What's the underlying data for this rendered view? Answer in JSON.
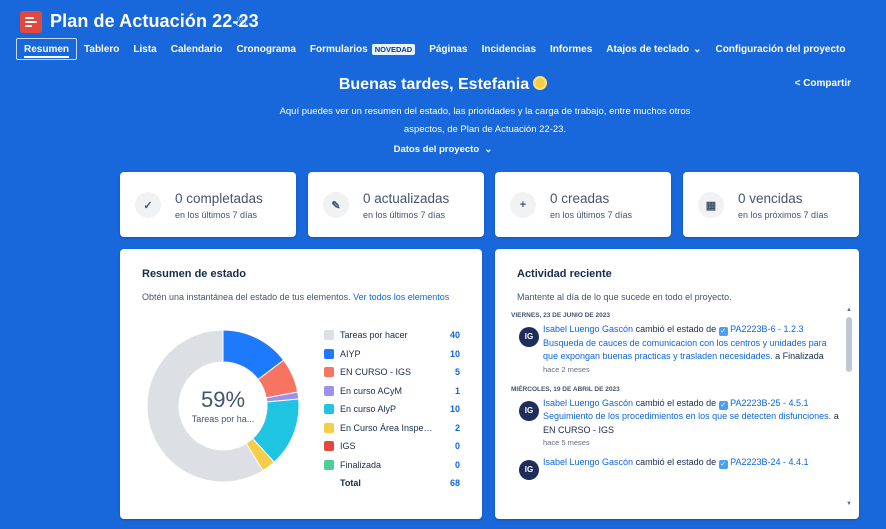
{
  "header": {
    "title": "Plan de Actuación 22-23",
    "tabs": [
      {
        "label": "Resumen",
        "active": true
      },
      {
        "label": "Tablero"
      },
      {
        "label": "Lista"
      },
      {
        "label": "Calendario"
      },
      {
        "label": "Cronograma"
      },
      {
        "label": "Formularios",
        "badge": "NOVEDAD"
      },
      {
        "label": "Páginas"
      },
      {
        "label": "Incidencias"
      },
      {
        "label": "Informes"
      },
      {
        "label": "Atajos de teclado",
        "chevron": true
      },
      {
        "label": "Configuración del proyecto"
      }
    ]
  },
  "hero": {
    "greeting": "Buenas tardes, Estefania",
    "share": "Compartir",
    "intro": "Aquí puedes ver un resumen del estado, las prioridades y la carga de trabajo, entre muchos otros aspectos, de Plan de Actuación 22-23.",
    "project_data": "Datos del proyecto"
  },
  "stats": [
    {
      "icon": "check-icon",
      "value": "0 completadas",
      "period": "en los últimos 7 días"
    },
    {
      "icon": "pencil-icon",
      "value": "0 actualizadas",
      "period": "en los últimos 7 días"
    },
    {
      "icon": "plus-icon",
      "value": "0 creadas",
      "period": "en los últimos 7 días"
    },
    {
      "icon": "calendar-icon",
      "value": "0 vencidas",
      "period": "en los próximos 7 días"
    }
  ],
  "status": {
    "title": "Resumen de estado",
    "subtitle": "Obtén una instantánea del estado de tus elementos.",
    "link": "Ver todos los elementos",
    "center_pct": "59%",
    "center_label": "Tareas por ha...",
    "items": [
      {
        "name": "Tareas por hacer",
        "value": 40,
        "color": "#dcdfe4"
      },
      {
        "name": "AIYP",
        "value": 10,
        "color": "#1d7afc"
      },
      {
        "name": "EN CURSO - IGS",
        "value": 5,
        "color": "#f87462"
      },
      {
        "name": "En curso ACyM",
        "value": 1,
        "color": "#9f8fef"
      },
      {
        "name": "En curso AlyP",
        "value": 10,
        "color": "#1fc4e0"
      },
      {
        "name": "En Curso Área Inspecci...",
        "value": 2,
        "color": "#f5cd47"
      },
      {
        "name": "IGS",
        "value": 0,
        "color": "#e2483d"
      },
      {
        "name": "Finalizada",
        "value": 0,
        "color": "#4bce97"
      }
    ],
    "total_label": "Total",
    "total_value": 68
  },
  "activity": {
    "title": "Actividad reciente",
    "subtitle": "Mantente al día de lo que sucede en todo el proyecto.",
    "groups": [
      {
        "day": "VIERNES, 23 DE JUNIO DE 2023",
        "user": "Isabel Luengo Gascón",
        "initials": "IG",
        "action": "cambió el estado de",
        "issue": "PA2223B-6 - 1.2.3 Busqueda de cauces de comunicacion con los centros y unidades para que expongan buenas practicas y trasladen necesidades.",
        "to": "a Finalizada",
        "time": "hace 2 meses"
      },
      {
        "day": "MIÉRCOLES, 19 DE ABRIL DE 2023",
        "user": "Isabel Luengo Gascón",
        "initials": "IG",
        "action": "cambió el estado de",
        "issue": "PA2223B-25 - 4.5.1 Seguimiento de los procedimientos en los que se detecten disfunciones.",
        "to": "a EN CURSO - IGS",
        "time": "hace 5 meses"
      },
      {
        "day": "",
        "user": "Isabel Luengo Gascón",
        "initials": "IG",
        "action": "cambió el estado de",
        "issue": "PA2223B-24 - 4.4.1",
        "to": "",
        "time": ""
      }
    ]
  }
}
